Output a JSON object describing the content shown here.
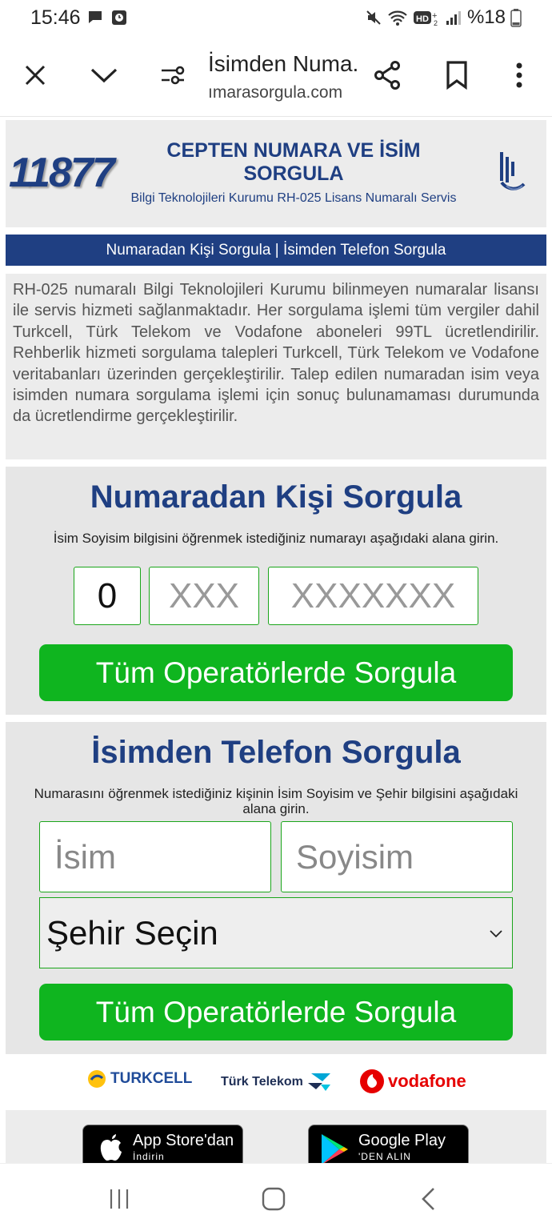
{
  "status_bar": {
    "time": "15:46",
    "battery": "%18"
  },
  "browser": {
    "tab_title": "İsimden Numa...",
    "domain": "ımarasorgula.com",
    "icons": [
      "close-icon",
      "chevron-down-icon",
      "site-settings-icon",
      "share-icon",
      "bookmark-icon",
      "more-icon"
    ]
  },
  "header": {
    "logo_number": "11877",
    "title": "CEPTEN NUMARA VE İSİM SORGULA",
    "subtitle": "Bilgi Teknolojileri Kurumu RH-025 Lisans Numaralı Servis"
  },
  "nav": {
    "link1": "Numaradan Kişi Sorgula",
    "separator": " | ",
    "link2": "İsimden Telefon Sorgula"
  },
  "info_text": "RH-025 numaralı Bilgi Teknolojileri Kurumu bilinmeyen numaralar lisansı ile servis hizmeti sağlanmaktadır. Her sorgulama işlemi tüm vergiler dahil Turkcell, Türk Telekom ve Vodafone aboneleri 99TL ücretlendirilir. Rehberlik hizmeti sorgulama talepleri Turkcell, Türk Telekom ve Vodafone veritabanları üzerinden gerçekleştirilir. Talep edilen numaradan isim veya isimden numara sorgulama işlemi için sonuç bulunamaması durumunda da ücretlendirme gerçekleştirilir.",
  "number_search": {
    "title": "Numaradan Kişi Sorgula",
    "description": "İsim Soyisim bilgisini öğrenmek istediğiniz numarayı aşağıdaki alana girin.",
    "prefix_value": "0",
    "area_placeholder": "XXX",
    "number_placeholder": "XXXXXXX",
    "button": "Tüm Operatörlerde Sorgula"
  },
  "name_search": {
    "title": "İsimden Telefon Sorgula",
    "description": "Numarasını öğrenmek istediğiniz kişinin İsim Soyisim ve Şehir bilgisini aşağıdaki alana girin.",
    "name_placeholder": "İsim",
    "surname_placeholder": "Soyisim",
    "city_select": "Şehir Seçin",
    "button": "Tüm Operatörlerde Sorgula"
  },
  "operators": {
    "turkcell": "TURKCELL",
    "turk_telekom": "Türk Telekom",
    "vodafone": "vodafone"
  },
  "stores": {
    "appstore_main": "App Store'dan",
    "appstore_sub": "İndirin",
    "googleplay_main": "Google Play",
    "googleplay_sub": "'DEN ALIN"
  },
  "colors": {
    "brand_blue": "#1f3f82",
    "button_green": "#0fb51f",
    "vodafone_red": "#e60000"
  }
}
